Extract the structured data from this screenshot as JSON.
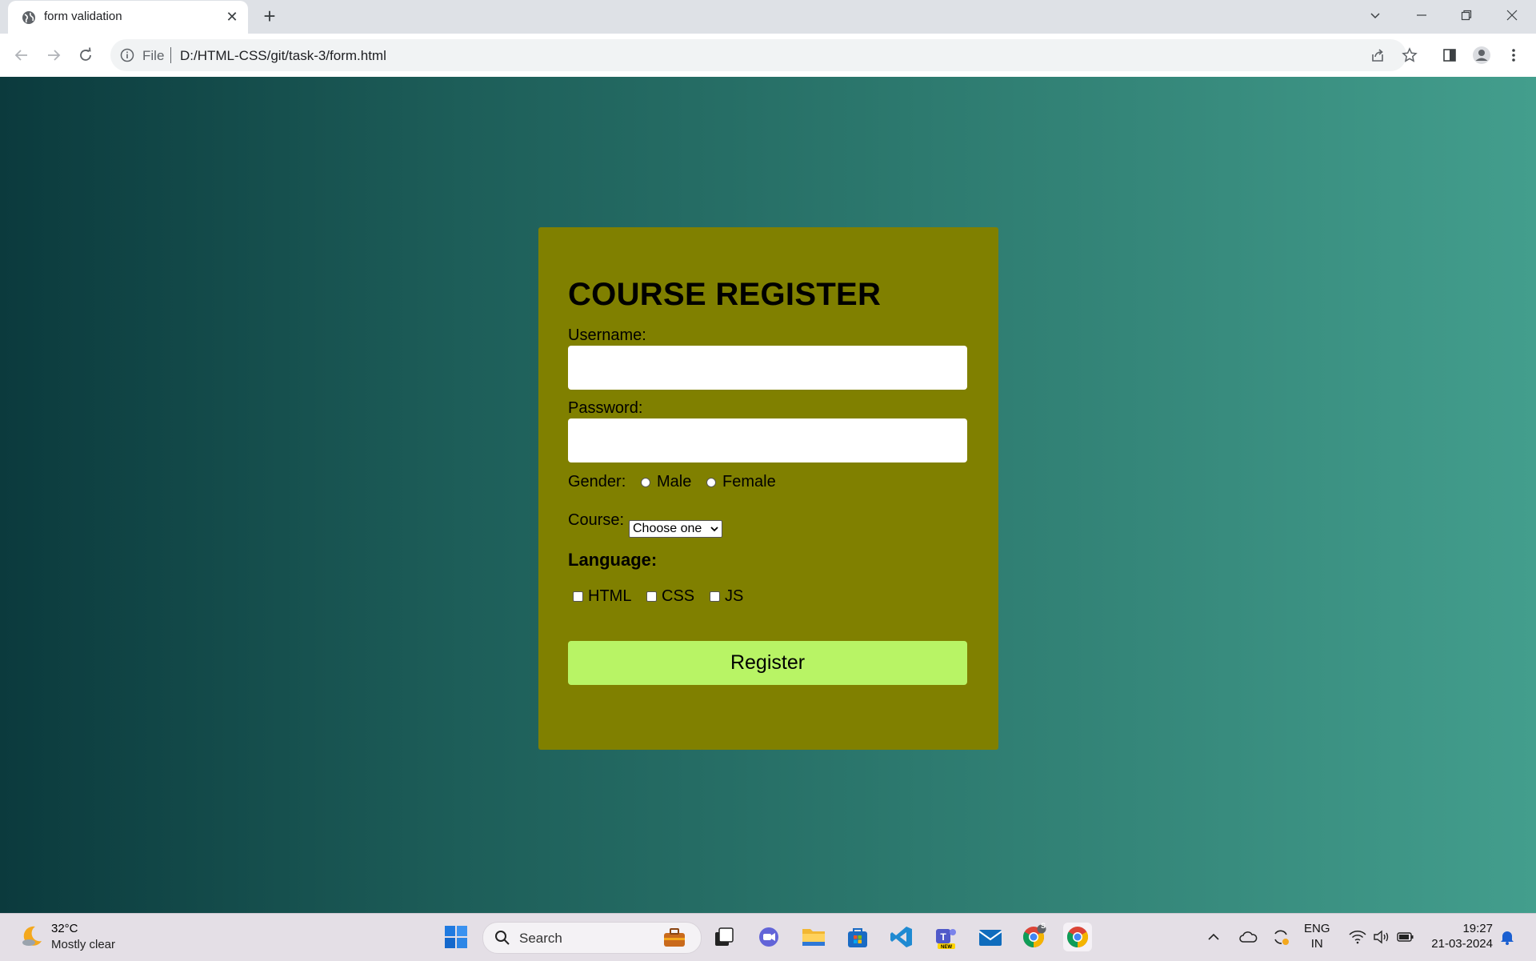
{
  "browser": {
    "tab_title": "form validation",
    "address_scheme": "File",
    "address_url": "D:/HTML-CSS/git/task-3/form.html"
  },
  "form": {
    "title": "COURSE REGISTER",
    "username_label": "Username:",
    "username_value": "",
    "password_label": "Password:",
    "password_value": "",
    "gender_label": "Gender:",
    "gender_options": [
      "Male",
      "Female"
    ],
    "course_label": "Course:",
    "course_selected": "Choose one",
    "language_label": "Language:",
    "language_options": [
      "HTML",
      "CSS",
      "JS"
    ],
    "register_label": "Register"
  },
  "colors": {
    "card": "#808000",
    "register_button": "#b8f465",
    "gradient_left": "#0b3a3d",
    "gradient_right": "#439e8d"
  },
  "taskbar": {
    "temperature": "32°C",
    "weather": "Mostly clear",
    "search_placeholder": "Search",
    "lang_top": "ENG",
    "lang_bottom": "IN",
    "time": "19:27",
    "date": "21-03-2024",
    "chrome_badge": "S"
  }
}
